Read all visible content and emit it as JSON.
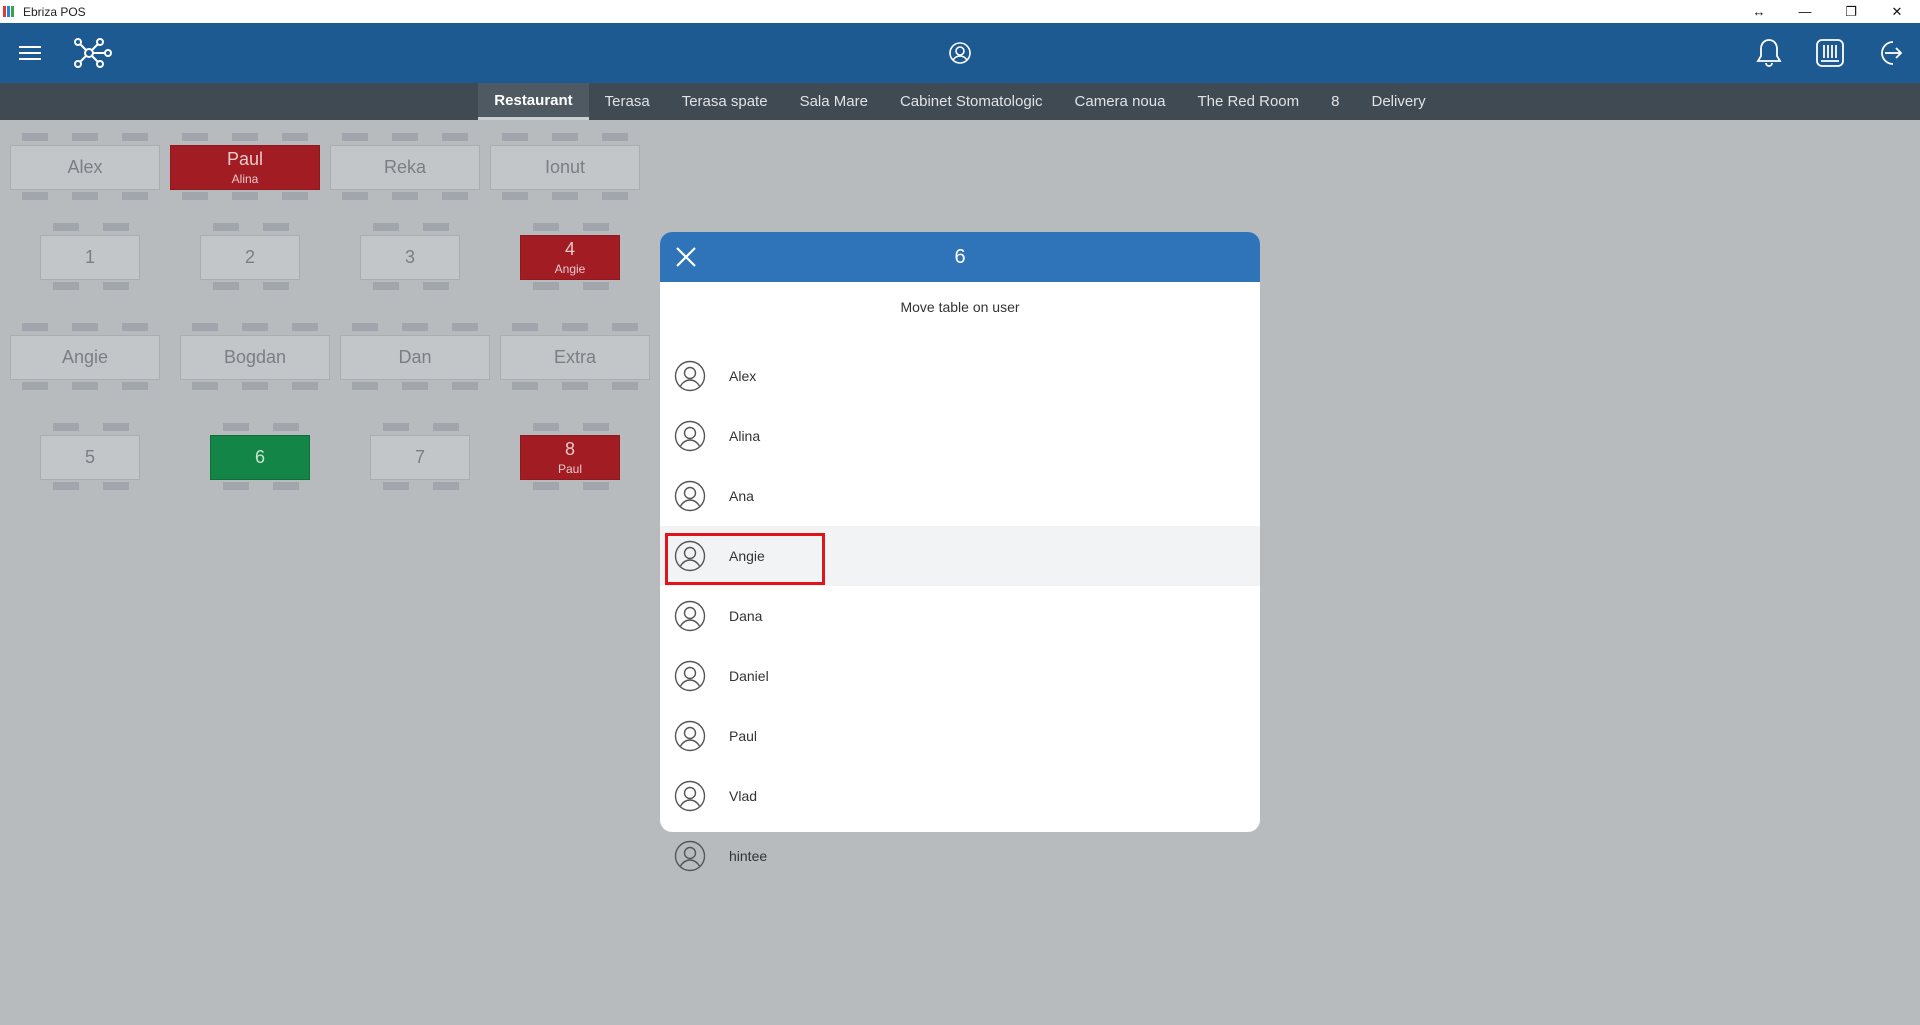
{
  "window": {
    "title": "Ebriza POS",
    "restore_glyph": "↔",
    "minimize_glyph": "—",
    "maximize_glyph": "❐",
    "close_glyph": "✕"
  },
  "header": {
    "menu_icon": "menu-icon",
    "network_icon": "network-icon",
    "user_icon": "user-circle-icon",
    "bell_icon": "bell-icon",
    "register_icon": "cash-register-icon",
    "logout_icon": "logout-icon"
  },
  "tabs": [
    {
      "label": "Restaurant",
      "active": true
    },
    {
      "label": "Terasa"
    },
    {
      "label": "Terasa spate"
    },
    {
      "label": "Sala Mare"
    },
    {
      "label": "Cabinet Stomatologic"
    },
    {
      "label": "Camera noua"
    },
    {
      "label": "The Red Room"
    },
    {
      "label": "8"
    },
    {
      "label": "Delivery"
    }
  ],
  "tables": [
    {
      "label": "Alex",
      "sub": ""
    },
    {
      "label": "Paul",
      "sub": "Alina",
      "state": "occupied"
    },
    {
      "label": "Reka",
      "sub": ""
    },
    {
      "label": "Ionut",
      "sub": ""
    },
    {
      "label": "1",
      "sub": ""
    },
    {
      "label": "2",
      "sub": ""
    },
    {
      "label": "3",
      "sub": ""
    },
    {
      "label": "4",
      "sub": "Angie",
      "state": "occupied"
    },
    {
      "label": "Angie",
      "sub": ""
    },
    {
      "label": "Bogdan",
      "sub": ""
    },
    {
      "label": "Dan",
      "sub": ""
    },
    {
      "label": "Extra",
      "sub": ""
    },
    {
      "label": "5",
      "sub": ""
    },
    {
      "label": "6",
      "sub": "",
      "state": "selected"
    },
    {
      "label": "7",
      "sub": ""
    },
    {
      "label": "8",
      "sub": "Paul",
      "state": "occupied"
    }
  ],
  "colors": {
    "header": "#1c5a91",
    "tabs_bg": "#404a52",
    "modal_header": "#2f73b9",
    "occupied": "#a21d23",
    "selected": "#138546",
    "highlight_outline": "#e0141b"
  },
  "modal": {
    "title": "6",
    "subtitle": "Move table on user",
    "users": [
      "Alex",
      "Alina",
      "Ana",
      "Angie",
      "Dana",
      "Daniel",
      "Paul",
      "Vlad",
      "hintee"
    ],
    "highlighted_user": "Angie"
  }
}
